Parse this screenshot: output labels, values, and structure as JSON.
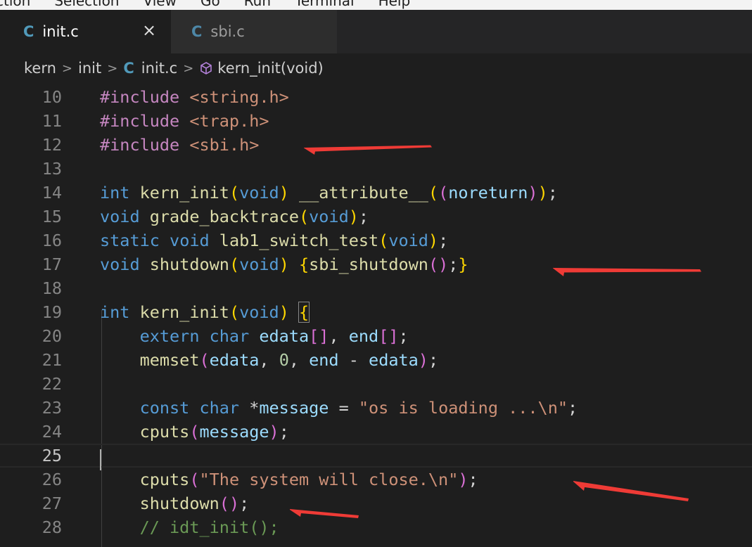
{
  "menu": [
    "ction",
    "Selection",
    "View",
    "Go",
    "Run",
    "Terminal",
    "Help"
  ],
  "tabs": [
    {
      "icon": "C",
      "label": "init.c",
      "close": "×"
    },
    {
      "icon": "C",
      "label": "sbi.c"
    }
  ],
  "breadcrumb": {
    "items": [
      "kern",
      "init",
      "init.c",
      "kern_init(void)"
    ],
    "file_icon": "C",
    "separator": ">"
  },
  "lines": [
    {
      "n": "10",
      "tokens": [
        [
          "#include ",
          "pp"
        ],
        [
          "<string.h>",
          "str"
        ]
      ]
    },
    {
      "n": "11",
      "tokens": [
        [
          "#include ",
          "pp"
        ],
        [
          "<trap.h>",
          "str"
        ]
      ]
    },
    {
      "n": "12",
      "tokens": [
        [
          "#include ",
          "pp"
        ],
        [
          "<sbi.h>",
          "str"
        ]
      ]
    },
    {
      "n": "13",
      "tokens": []
    },
    {
      "n": "14",
      "tokens": [
        [
          "int ",
          "kw"
        ],
        [
          "kern_init",
          "fn"
        ],
        [
          "(",
          "br1"
        ],
        [
          "void",
          "kw"
        ],
        [
          ")",
          "br1"
        ],
        [
          " __attribute__",
          "fn"
        ],
        [
          "(",
          "br1"
        ],
        [
          "(",
          "br2"
        ],
        [
          "noreturn",
          "var"
        ],
        [
          ")",
          "br2"
        ],
        [
          ")",
          "br1"
        ],
        [
          ";",
          "pl"
        ]
      ]
    },
    {
      "n": "15",
      "tokens": [
        [
          "void ",
          "kw"
        ],
        [
          "grade_backtrace",
          "fn"
        ],
        [
          "(",
          "br1"
        ],
        [
          "void",
          "kw"
        ],
        [
          ")",
          "br1"
        ],
        [
          ";",
          "pl"
        ]
      ]
    },
    {
      "n": "16",
      "tokens": [
        [
          "static ",
          "kw"
        ],
        [
          "void ",
          "kw"
        ],
        [
          "lab1_switch_test",
          "fn"
        ],
        [
          "(",
          "br1"
        ],
        [
          "void",
          "kw"
        ],
        [
          ")",
          "br1"
        ],
        [
          ";",
          "pl"
        ]
      ]
    },
    {
      "n": "17",
      "tokens": [
        [
          "void ",
          "kw"
        ],
        [
          "shutdown",
          "fn"
        ],
        [
          "(",
          "br1"
        ],
        [
          "void",
          "kw"
        ],
        [
          ")",
          "br1"
        ],
        [
          " ",
          "pl"
        ],
        [
          "{",
          "br1"
        ],
        [
          "sbi_shutdown",
          "fn"
        ],
        [
          "(",
          "br2"
        ],
        [
          ")",
          "br2"
        ],
        [
          ";",
          "pl"
        ],
        [
          "}",
          "br1"
        ]
      ]
    },
    {
      "n": "18",
      "tokens": []
    },
    {
      "n": "19",
      "tokens": [
        [
          "int ",
          "kw"
        ],
        [
          "kern_init",
          "fn"
        ],
        [
          "(",
          "br1"
        ],
        [
          "void",
          "kw"
        ],
        [
          ")",
          "br1"
        ],
        [
          " ",
          "pl"
        ],
        [
          "{",
          "br1 bmatch"
        ]
      ]
    },
    {
      "n": "20",
      "tokens": [
        [
          "    extern ",
          "kw"
        ],
        [
          "char ",
          "kw"
        ],
        [
          "edata",
          "var"
        ],
        [
          "[",
          "br2"
        ],
        [
          "]",
          "br2"
        ],
        [
          ", ",
          "pl"
        ],
        [
          "end",
          "var"
        ],
        [
          "[",
          "br2"
        ],
        [
          "]",
          "br2"
        ],
        [
          ";",
          "pl"
        ]
      ]
    },
    {
      "n": "21",
      "tokens": [
        [
          "    memset",
          "fn"
        ],
        [
          "(",
          "br2"
        ],
        [
          "edata",
          "var"
        ],
        [
          ", ",
          "pl"
        ],
        [
          "0",
          "num"
        ],
        [
          ", ",
          "pl"
        ],
        [
          "end",
          "var"
        ],
        [
          " - ",
          "pl"
        ],
        [
          "edata",
          "var"
        ],
        [
          ")",
          "br2"
        ],
        [
          ";",
          "pl"
        ]
      ]
    },
    {
      "n": "22",
      "tokens": []
    },
    {
      "n": "23",
      "tokens": [
        [
          "    const ",
          "kw"
        ],
        [
          "char ",
          "kw"
        ],
        [
          "*",
          "pl"
        ],
        [
          "message",
          "var"
        ],
        [
          " = ",
          "pl"
        ],
        [
          "\"os is loading ...\\n\"",
          "str"
        ],
        [
          ";",
          "pl"
        ]
      ]
    },
    {
      "n": "24",
      "tokens": [
        [
          "    cputs",
          "fn"
        ],
        [
          "(",
          "br2"
        ],
        [
          "message",
          "var"
        ],
        [
          ")",
          "br2"
        ],
        [
          ";",
          "pl"
        ]
      ]
    },
    {
      "n": "25",
      "tokens": [],
      "current": true
    },
    {
      "n": "26",
      "tokens": [
        [
          "    cputs",
          "fn"
        ],
        [
          "(",
          "br2"
        ],
        [
          "\"The system will close.\\n\"",
          "str"
        ],
        [
          ")",
          "br2"
        ],
        [
          ";",
          "pl"
        ]
      ]
    },
    {
      "n": "27",
      "tokens": [
        [
          "    shutdown",
          "fn"
        ],
        [
          "(",
          "br2"
        ],
        [
          ")",
          "br2"
        ],
        [
          ";",
          "pl"
        ]
      ]
    },
    {
      "n": "28",
      "tokens": [
        [
          "    // idt_init();",
          "cm"
        ]
      ]
    }
  ],
  "colors": {
    "editor_bg": "#1e1e1e",
    "annotation_arrow": "#ef3b36",
    "tab_icon": "#519aba"
  }
}
